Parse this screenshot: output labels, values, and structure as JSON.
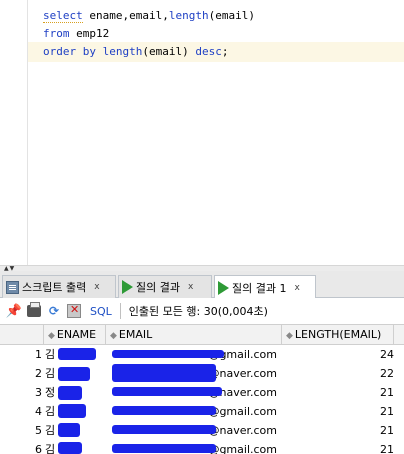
{
  "editor": {
    "lines": [
      {
        "kw1": "select",
        "rest": " ename,email,",
        "fn": "length",
        "tail": "(email)"
      },
      {
        "kw1": "from",
        "rest": " emp12"
      },
      {
        "kw1": "order by",
        "fn": "length",
        "tail": "(email)",
        "kw2": "desc",
        "end": ";"
      }
    ]
  },
  "tabs": [
    {
      "label": "스크립트 출력",
      "close": "x",
      "icon": "script-output-icon"
    },
    {
      "label": "질의 결과",
      "close": "x",
      "icon": "run-icon"
    },
    {
      "label": "질의 결과 1",
      "close": "x",
      "icon": "run-icon"
    }
  ],
  "toolbar": {
    "sql_label": "SQL",
    "status": "인출된 모든 행: 30(0,004초)"
  },
  "grid": {
    "columns": [
      "ENAME",
      "EMAIL",
      "LENGTH(EMAIL)"
    ],
    "rows": [
      {
        "num": "1",
        "ename": "김",
        "email": "@gmail.com",
        "length": "24"
      },
      {
        "num": "2",
        "ename": "김",
        "email": "@naver.com",
        "length": "22"
      },
      {
        "num": "3",
        "ename": "정",
        "email": "@naver.com",
        "length": "21"
      },
      {
        "num": "4",
        "ename": "김",
        "email": "@gmail.com",
        "length": "21"
      },
      {
        "num": "5",
        "ename": "김",
        "email": "@naver.com",
        "length": "21"
      },
      {
        "num": "6",
        "ename": "김",
        "email": "@gmail.com",
        "length": "21"
      }
    ]
  },
  "colors": {
    "keyword": "#1e3fc4",
    "redaction": "#1a23e8",
    "current_line": "#fcf7e4"
  }
}
